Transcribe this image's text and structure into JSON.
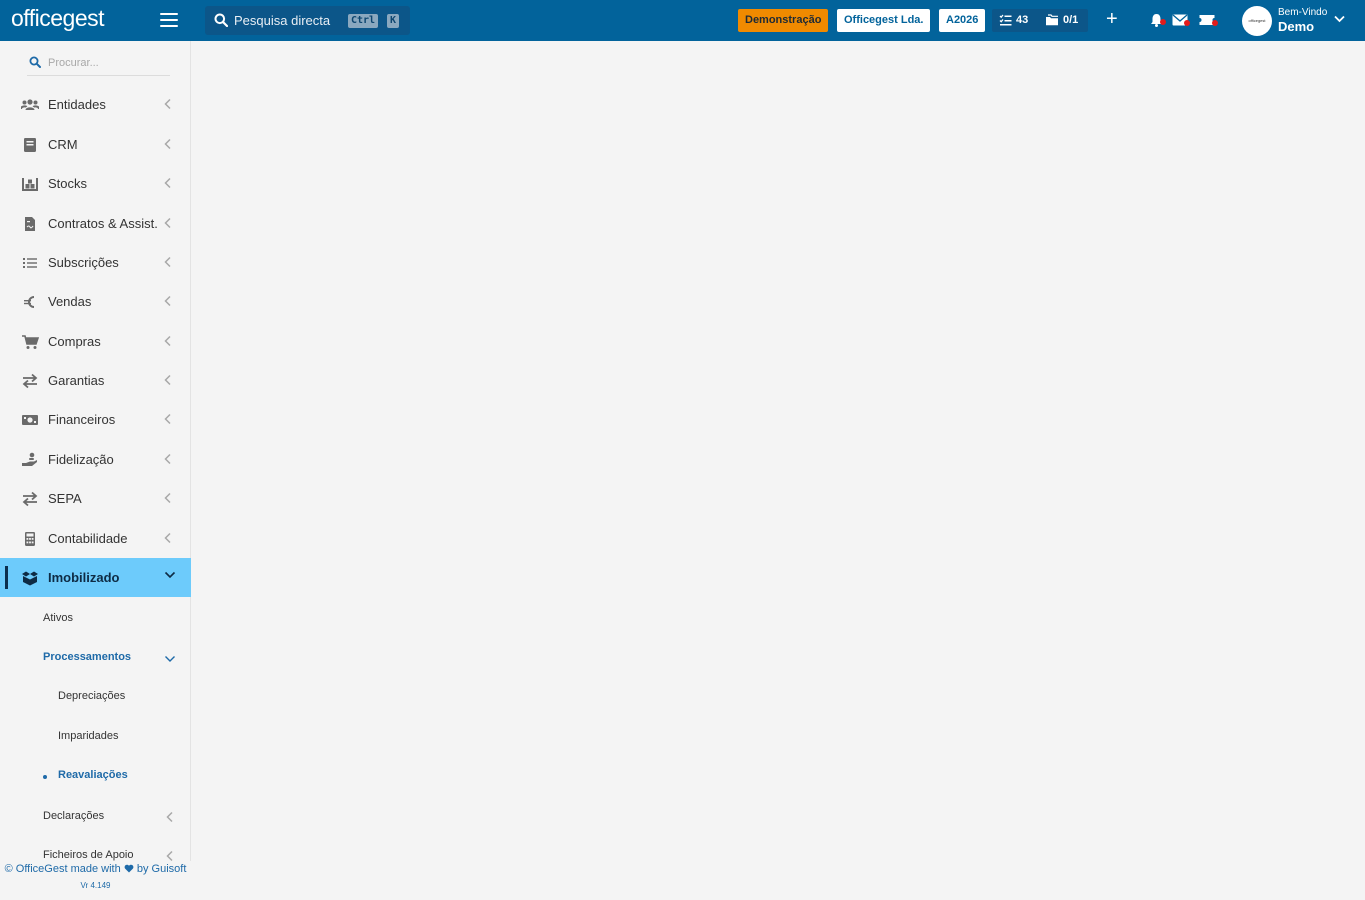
{
  "brand": {
    "logo_text": "officegest"
  },
  "header": {
    "search_placeholder": "Pesquisa directa",
    "shortcut_ctrl": "Ctrl",
    "shortcut_key": "K",
    "badge_demo": "Demonstração",
    "badge_company": "Officegest Lda.",
    "badge_year": "A2026",
    "tasks_count": "43",
    "folders_count": "0/1",
    "add_label": "+",
    "welcome": "Bem-Vindo",
    "username": "Demo",
    "avatar_text": "officegest"
  },
  "sidebar": {
    "search_placeholder": "Procurar...",
    "items": [
      {
        "label": "Entidades",
        "icon": "users-icon"
      },
      {
        "label": "CRM",
        "icon": "book-icon"
      },
      {
        "label": "Stocks",
        "icon": "warehouse-icon"
      },
      {
        "label": "Contratos & Assist.",
        "icon": "contract-icon"
      },
      {
        "label": "Subscrições",
        "icon": "list-icon"
      },
      {
        "label": "Vendas",
        "icon": "euro-icon"
      },
      {
        "label": "Compras",
        "icon": "cart-icon"
      },
      {
        "label": "Garantias",
        "icon": "exchange-icon"
      },
      {
        "label": "Financeiros",
        "icon": "money-icon"
      },
      {
        "label": "Fidelização",
        "icon": "hand-coins-icon"
      },
      {
        "label": "SEPA",
        "icon": "exchange-icon"
      },
      {
        "label": "Contabilidade",
        "icon": "calculator-icon"
      },
      {
        "label": "Imobilizado",
        "icon": "boxes-icon"
      }
    ],
    "sub_items": {
      "ativos": "Ativos",
      "processamentos": "Processamentos",
      "depreciacoes": "Depreciações",
      "imparidades": "Imparidades",
      "reavaliacoes": "Reavaliações",
      "declaracoes": "Declarações",
      "ficheiros": "Ficheiros de Apoio"
    }
  },
  "footer": {
    "credit_prefix": "© OfficeGest made with",
    "credit_suffix": "by Guisoft",
    "version": "Vr 4.149"
  },
  "colors": {
    "topbar": "#02639b",
    "active_item": "#6dcbfb",
    "demo_badge": "#f08a00",
    "link": "#1e6aa8"
  }
}
